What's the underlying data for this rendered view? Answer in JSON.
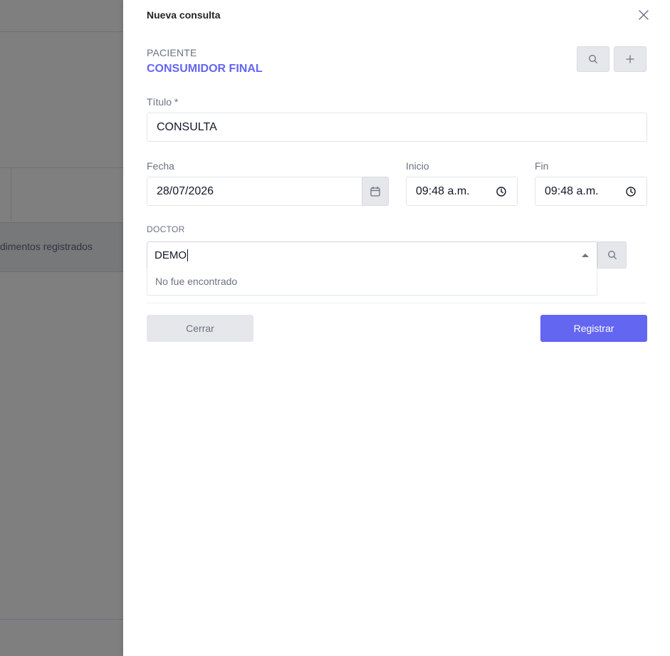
{
  "background": {
    "row_text": "dimentos registrados"
  },
  "dialog": {
    "title": "Nueva consulta",
    "close_icon": "close-icon"
  },
  "patient": {
    "label": "PACIENTE",
    "name": "CONSUMIDOR FINAL",
    "search_icon": "search-icon",
    "add_icon": "plus-icon"
  },
  "form": {
    "title_label": "Título *",
    "title_value": "CONSULTA",
    "date_label": "Fecha",
    "date_value": "28/07/2026",
    "start_label": "Inicio",
    "start_value": "09:48 a.m.",
    "end_label": "Fin",
    "end_value": "09:48 a.m.",
    "doctor_label": "DOCTOR",
    "doctor_value": "DEMO",
    "doctor_no_results": "No fue encontrado"
  },
  "actions": {
    "close_label": "Cerrar",
    "register_label": "Registrar"
  },
  "colors": {
    "accent": "#6366f1",
    "overlay": "#7f7f80"
  }
}
